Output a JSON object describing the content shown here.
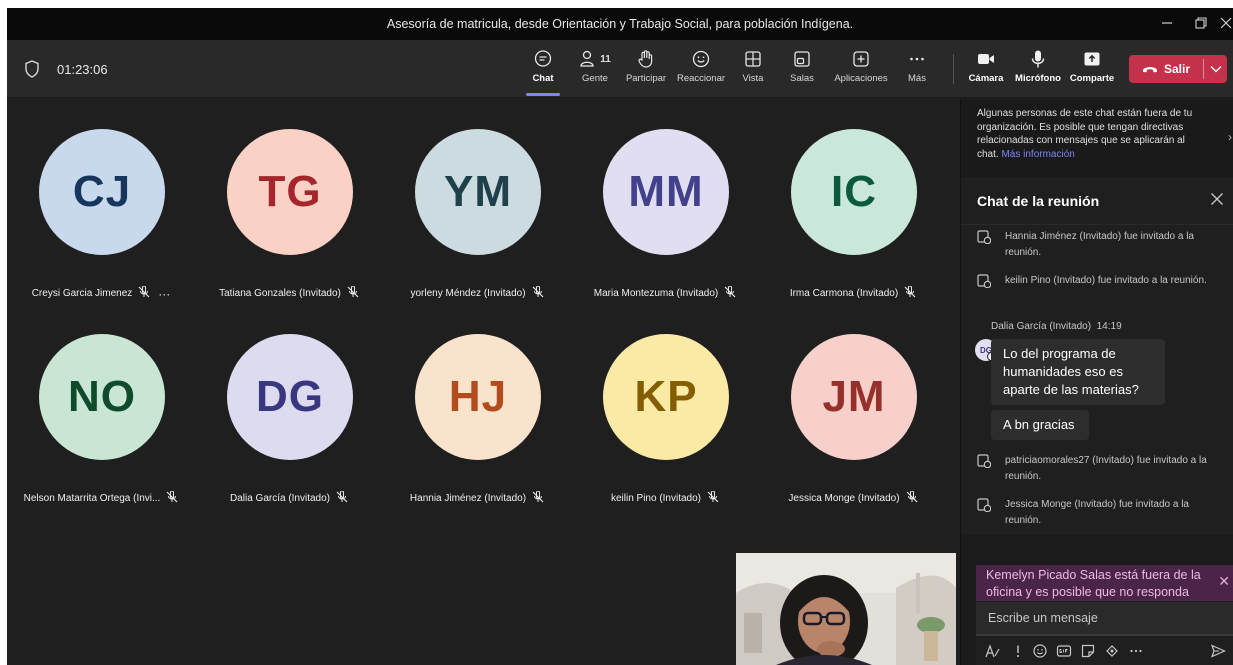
{
  "window": {
    "title": "Asesoría de matricula, desde Orientación y Trabajo Social, para población Indígena."
  },
  "toolbar": {
    "timer": "01:23:06",
    "people_count": "11",
    "buttons": [
      {
        "label": "Chat",
        "icon": "chat-icon"
      },
      {
        "label": "Gente",
        "icon": "people-icon"
      },
      {
        "label": "Participar",
        "icon": "raise-hand-icon"
      },
      {
        "label": "Reaccionar",
        "icon": "smile-icon"
      },
      {
        "label": "Vista",
        "icon": "grid-view-icon"
      },
      {
        "label": "Salas",
        "icon": "breakout-rooms-icon"
      },
      {
        "label": "Aplicaciones",
        "icon": "add-apps-icon"
      },
      {
        "label": "Más",
        "icon": "more-icon"
      },
      {
        "label": "Cámara",
        "icon": "camera-icon"
      },
      {
        "label": "Micrófono",
        "icon": "microphone-icon"
      },
      {
        "label": "Comparte",
        "icon": "share-icon"
      }
    ],
    "leave_label": "Salir"
  },
  "participants": [
    {
      "initials": "CJ",
      "name": "Creysi Garcia Jimenez",
      "bg": "#c8d9ee",
      "fg": "#17365d"
    },
    {
      "initials": "TG",
      "name": "Tatiana Gonzales (Invitado)",
      "bg": "#f9d2c5",
      "fg": "#a4262c"
    },
    {
      "initials": "YM",
      "name": "yorleny Méndez (Invitado)",
      "bg": "#cbdbe0",
      "fg": "#1f3f4a"
    },
    {
      "initials": "MM",
      "name": "Maria Montezuma (Invitado)",
      "bg": "#e0def0",
      "fg": "#43418c"
    },
    {
      "initials": "IC",
      "name": "Irma Carmona (Invitado)",
      "bg": "#c9e8da",
      "fg": "#0c5a3e"
    },
    {
      "initials": "NO",
      "name": "Nelson Matarrita Ortega (Invi...",
      "bg": "#c9e5d3",
      "fg": "#0f4a2a"
    },
    {
      "initials": "DG",
      "name": "Dalia García (Invitado)",
      "bg": "#dddbef",
      "fg": "#3b3680"
    },
    {
      "initials": "HJ",
      "name": "Hannia Jiménez (Invitado)",
      "bg": "#f9e3cc",
      "fg": "#b14d1c"
    },
    {
      "initials": "KP",
      "name": "keilin Pino (Invitado)",
      "bg": "#fbeaa6",
      "fg": "#845d00"
    },
    {
      "initials": "JM",
      "name": "Jessica Monge (Invitado)",
      "bg": "#f7d0cc",
      "fg": "#96302a"
    }
  ],
  "chat_panel": {
    "external_notice": "Algunas personas de este chat están fuera de tu organización. Es posible que tengan directivas relacionadas con mensajes que se aplicarán al chat.",
    "external_notice_link": "Más información",
    "title": "Chat de la reunión",
    "system_messages_top": [
      "Hannia Jiménez (Invitado) fue invitado a la reunión.",
      "keilin Pino (Invitado) fue invitado a la reunión."
    ],
    "message": {
      "sender": "Dalia García (Invitado)",
      "time": "14:19",
      "avatar_initials": "DG",
      "text": "Lo del programa de humanidades eso es aparte de las materias?",
      "followup": "A bn gracias"
    },
    "system_messages_bottom": [
      "patriciaomorales27 (Invitado) fue invitado a la reunión.",
      "Jessica Monge (Invitado) fue invitado a la reunión."
    ],
    "out_of_office": "Kemelyn Picado Salas está fuera de la oficina y es posible que no responda",
    "composer_placeholder": "Escribe un mensaje"
  }
}
